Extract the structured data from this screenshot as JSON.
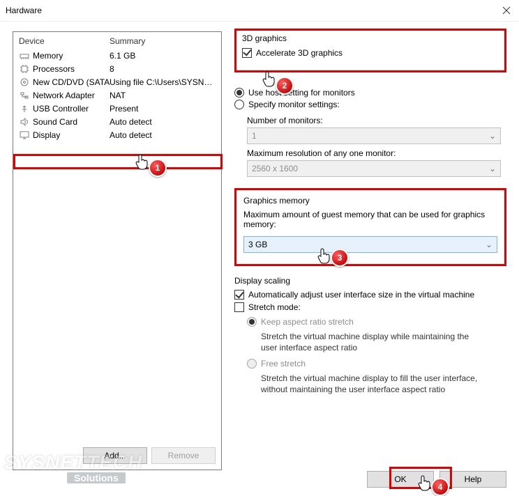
{
  "window": {
    "title": "Hardware"
  },
  "deviceTable": {
    "headers": {
      "device": "Device",
      "summary": "Summary"
    },
    "rows": [
      {
        "name": "Memory",
        "summary": "6.1 GB",
        "icon": "memory"
      },
      {
        "name": "Processors",
        "summary": "8",
        "icon": "cpu"
      },
      {
        "name": "New CD/DVD (SATA)",
        "summary": "Using file C:\\Users\\SYSNETT...",
        "icon": "disc"
      },
      {
        "name": "Network Adapter",
        "summary": "NAT",
        "icon": "net"
      },
      {
        "name": "USB Controller",
        "summary": "Present",
        "icon": "usb"
      },
      {
        "name": "Sound Card",
        "summary": "Auto detect",
        "icon": "sound"
      },
      {
        "name": "Display",
        "summary": "Auto detect",
        "icon": "display"
      }
    ],
    "buttons": {
      "add": "Add...",
      "remove": "Remove"
    }
  },
  "g3d": {
    "title": "3D graphics",
    "accelerate": "Accelerate 3D graphics"
  },
  "monitors": {
    "useHost": "Use host setting for monitors",
    "specify": "Specify monitor settings:",
    "numLabel": "Number of monitors:",
    "numValue": "1",
    "maxResLabel": "Maximum resolution of any one monitor:",
    "maxResValue": "2560 x 1600"
  },
  "gmem": {
    "title": "Graphics memory",
    "desc": "Maximum amount of guest memory that can be used for graphics memory:",
    "value": "3 GB"
  },
  "scaling": {
    "title": "Display scaling",
    "auto": "Automatically adjust user interface size in the virtual machine",
    "stretch": "Stretch mode:",
    "keep": "Keep aspect ratio stretch",
    "keepDesc": "Stretch the virtual machine display while maintaining the user interface aspect ratio",
    "free": "Free stretch",
    "freeDesc": "Stretch the virtual machine display to fill the user interface, without maintaining the user interface aspect ratio"
  },
  "footer": {
    "ok": "OK",
    "help": "Help"
  },
  "badges": {
    "b1": "1",
    "b2": "2",
    "b3": "3",
    "b4": "4"
  },
  "watermark": {
    "l1": "SYSNETTECH",
    "l2": "Solutions"
  }
}
